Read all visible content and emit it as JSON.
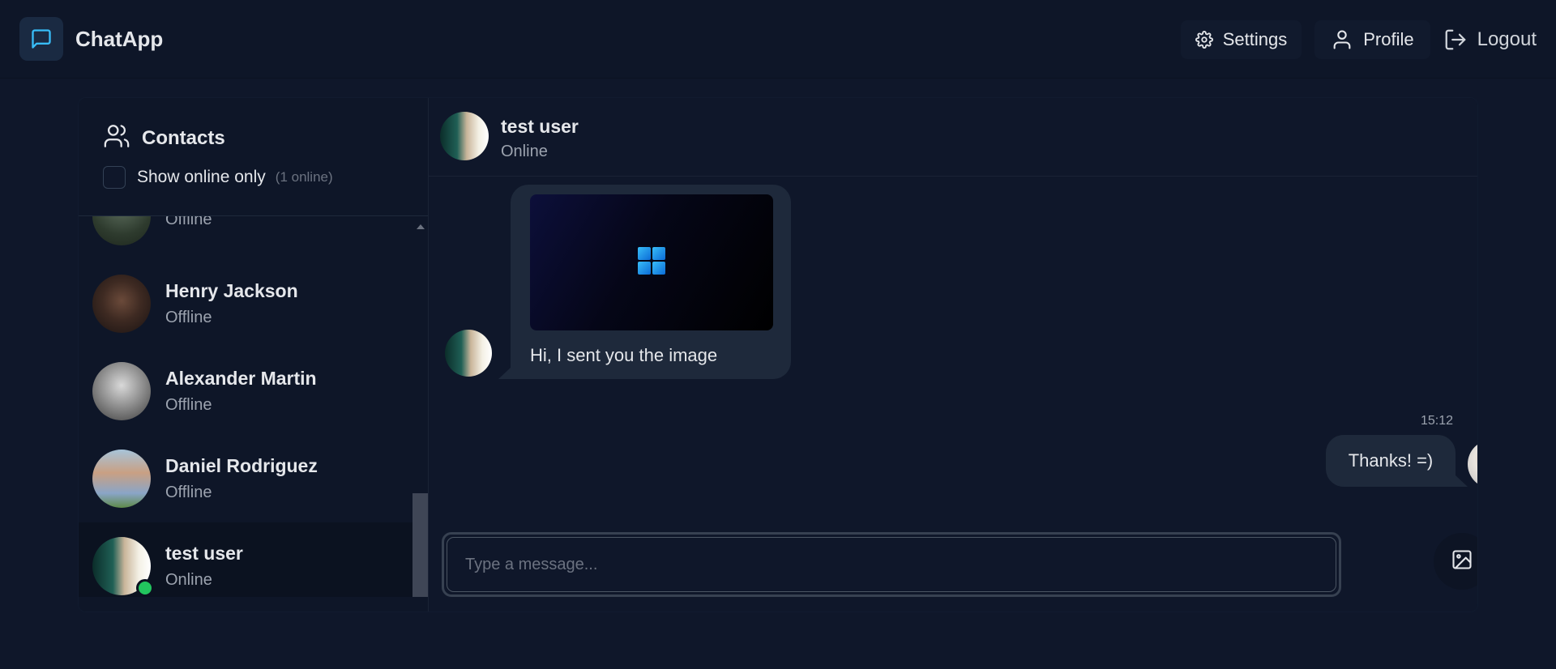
{
  "app": {
    "title": "ChatApp"
  },
  "nav": {
    "settings": "Settings",
    "profile": "Profile",
    "logout": "Logout"
  },
  "sidebar": {
    "title": "Contacts",
    "filter": {
      "label": "Show online only",
      "count": "(1 online)",
      "checked": false
    },
    "contacts": [
      {
        "name": "",
        "status": "Offline",
        "active": false,
        "online": false
      },
      {
        "name": "Henry Jackson",
        "status": "Offline",
        "active": false,
        "online": false
      },
      {
        "name": "Alexander Martin",
        "status": "Offline",
        "active": false,
        "online": false
      },
      {
        "name": "Daniel Rodriguez",
        "status": "Offline",
        "active": false,
        "online": false
      },
      {
        "name": "test user",
        "status": "Online",
        "active": true,
        "online": true
      }
    ]
  },
  "chat": {
    "header": {
      "name": "test user",
      "status": "Online"
    },
    "messages": [
      {
        "direction": "incoming",
        "has_image": true,
        "text": "Hi, I sent you the image"
      },
      {
        "direction": "outgoing",
        "time": "15:12",
        "text": "Thanks! =)"
      }
    ],
    "composer": {
      "placeholder": "Type a message...",
      "value": ""
    }
  },
  "colors": {
    "background": "#0f172a",
    "header": "#0e1628",
    "bubble": "#1e293b",
    "online": "#22c55e",
    "brand_icon": "#38bdf8"
  },
  "icons": {
    "brand": "message-square-icon",
    "settings": "gear-icon",
    "profile": "user-icon",
    "logout": "log-out-icon",
    "contacts": "users-icon",
    "close": "close-icon",
    "attach_image": "image-icon",
    "send": "send-icon",
    "windows_logo": "windows-logo-icon"
  }
}
